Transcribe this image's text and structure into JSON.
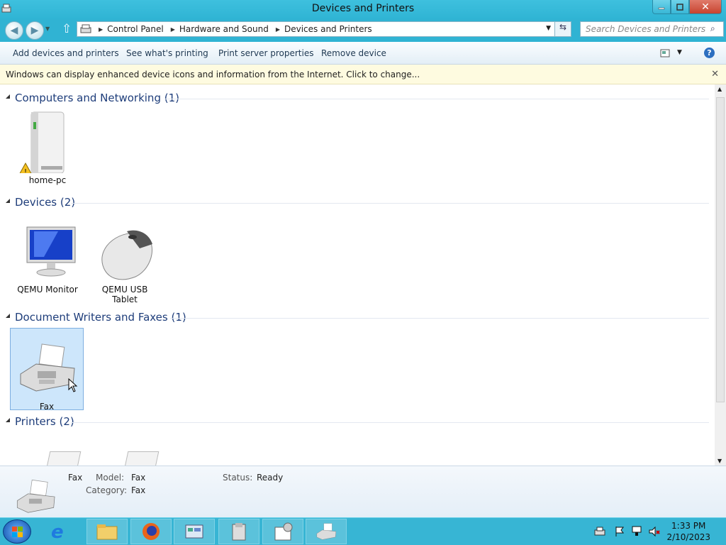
{
  "window": {
    "title": "Devices and Printers"
  },
  "address": {
    "crumbs": [
      "Control Panel",
      "Hardware and Sound",
      "Devices and Printers"
    ]
  },
  "search": {
    "placeholder": "Search Devices and Printers"
  },
  "toolbar": {
    "add_devices": "Add devices and printers",
    "see_printing": "See what's printing",
    "print_server": "Print server properties",
    "remove_device": "Remove device"
  },
  "infobar": {
    "text": "Windows can display enhanced device icons and information from the Internet. Click to change..."
  },
  "groups": {
    "computers": "Computers and Networking (1)",
    "devices": "Devices (2)",
    "writers": "Document Writers and Faxes (1)",
    "printers": "Printers (2)"
  },
  "items": {
    "home_pc": "home-pc",
    "qemu_monitor": "QEMU Monitor",
    "qemu_tablet_line1": "QEMU USB",
    "qemu_tablet_line2": "Tablet",
    "fax": "Fax"
  },
  "details": {
    "name": "Fax",
    "model_label": "Model:",
    "model_value": "Fax",
    "category_label": "Category:",
    "category_value": "Fax",
    "status_label": "Status:",
    "status_value": "Ready"
  },
  "clock": {
    "time": "1:33 PM",
    "date": "2/10/2023"
  },
  "colors": {
    "accent": "#30b3d3",
    "group_text": "#1e3d7a",
    "selection": "#cde6fb"
  }
}
